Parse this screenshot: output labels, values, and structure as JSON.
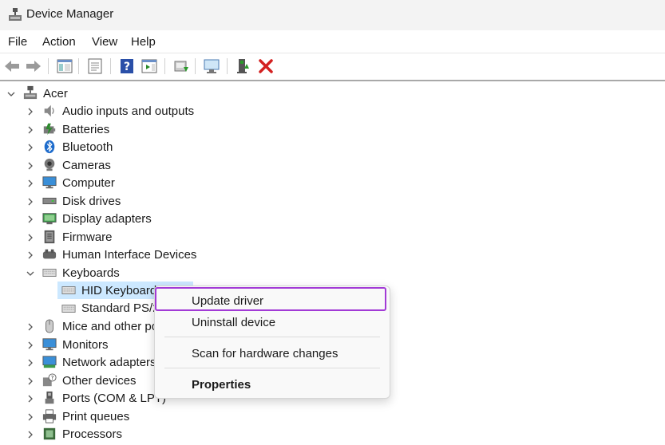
{
  "window": {
    "title": "Device Manager"
  },
  "menu": [
    "File",
    "Action",
    "View",
    "Help"
  ],
  "tree": {
    "root": "Acer",
    "categories": [
      "Audio inputs and outputs",
      "Batteries",
      "Bluetooth",
      "Cameras",
      "Computer",
      "Disk drives",
      "Display adapters",
      "Firmware",
      "Human Interface Devices",
      "Keyboards",
      "Mice and other po",
      "Monitors",
      "Network adapters",
      "Other devices",
      "Ports (COM & LPT)",
      "Print queues",
      "Processors"
    ],
    "keyboard_children": [
      "HID Keyboard",
      "Standard PS/2"
    ]
  },
  "context_menu": {
    "update": "Update driver",
    "uninstall": "Uninstall device",
    "scan": "Scan for hardware changes",
    "properties": "Properties"
  },
  "colors": {
    "highlight": "#a23ad6",
    "selection": "#cce8ff",
    "delete": "#d32020"
  }
}
